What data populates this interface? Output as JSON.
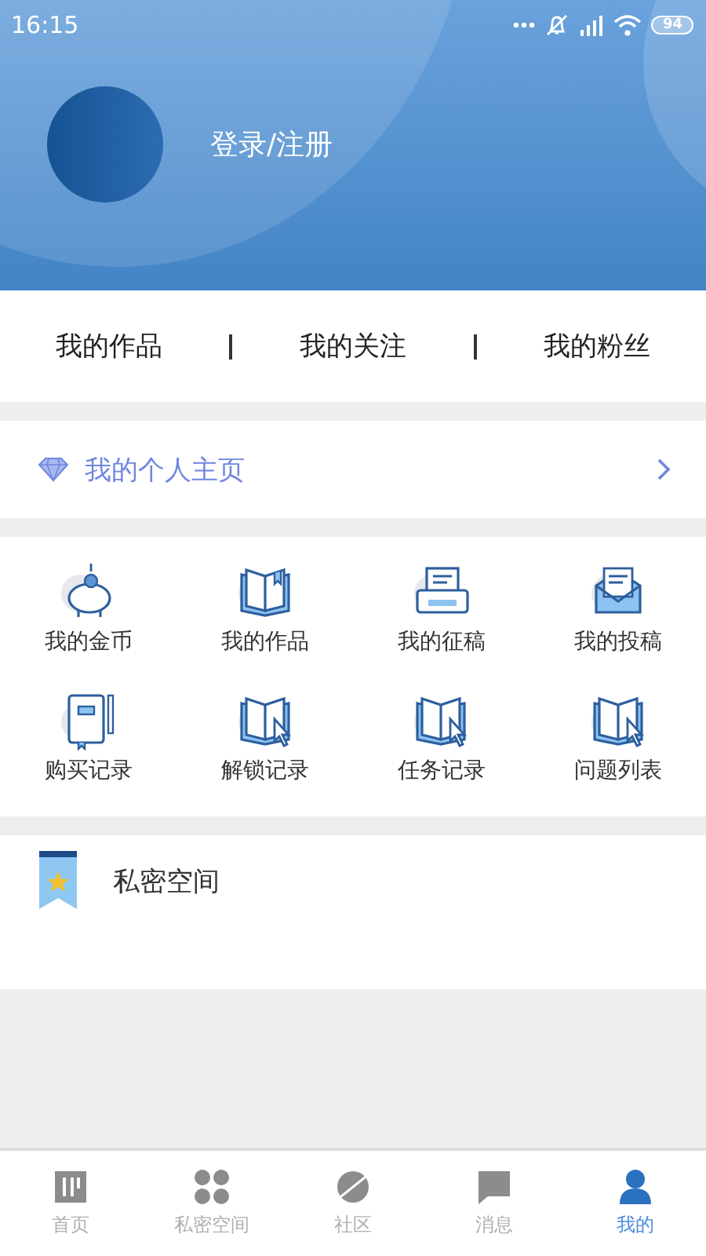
{
  "status_bar": {
    "time": "16:15",
    "battery": "94"
  },
  "profile": {
    "login": "登录/注册"
  },
  "stats": [
    {
      "label": "我的作品"
    },
    {
      "label": "我的关注"
    },
    {
      "label": "我的粉丝"
    }
  ],
  "homepage": {
    "label": "我的个人主页"
  },
  "shortcuts": [
    {
      "label": "我的金币",
      "kind": "coins"
    },
    {
      "label": "我的作品",
      "kind": "book"
    },
    {
      "label": "我的征稿",
      "kind": "printer"
    },
    {
      "label": "我的投稿",
      "kind": "envelope"
    },
    {
      "label": "购买记录",
      "kind": "notebook"
    },
    {
      "label": "解锁记录",
      "kind": "cursor"
    },
    {
      "label": "任务记录",
      "kind": "cursor"
    },
    {
      "label": "问题列表",
      "kind": "cursor"
    }
  ],
  "private_space": {
    "label": "私密空间"
  },
  "tab_bar": [
    {
      "label": "首页",
      "kind": "home",
      "selected": false
    },
    {
      "label": "私密空间",
      "kind": "grid",
      "selected": false
    },
    {
      "label": "社区",
      "kind": "planet",
      "selected": false
    },
    {
      "label": "消息",
      "kind": "chat",
      "selected": false
    },
    {
      "label": "我的",
      "kind": "person",
      "selected": true
    }
  ]
}
